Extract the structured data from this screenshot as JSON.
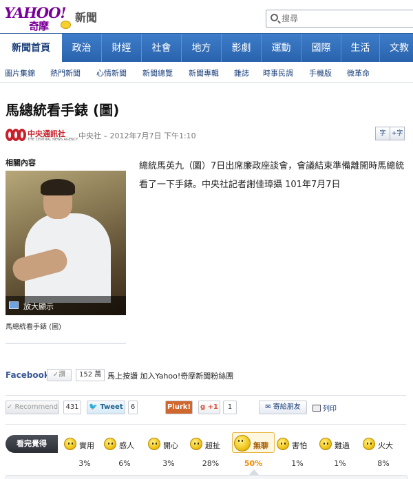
{
  "header": {
    "logo_text": "YAHOO!",
    "logo_sub": "奇摩",
    "section_name": "新聞",
    "search_placeholder": "搜尋"
  },
  "mainnav": {
    "tabs": [
      {
        "label": "新聞首頁",
        "active": true
      },
      {
        "label": "政治"
      },
      {
        "label": "財經"
      },
      {
        "label": "社會"
      },
      {
        "label": "地方"
      },
      {
        "label": "影劇"
      },
      {
        "label": "運動"
      },
      {
        "label": "國際"
      },
      {
        "label": "生活"
      },
      {
        "label": "文教"
      }
    ]
  },
  "subnav": {
    "items": [
      "圖片集錦",
      "熱門新聞",
      "心情新聞",
      "新聞總覽",
      "新聞專輯",
      "雜誌",
      "時事民調",
      "手機版",
      "微革命"
    ]
  },
  "article": {
    "title": "馬總統看手錶 (圖)",
    "source_logo_name": "中央通訊社",
    "source_logo_en": "THE CENTRAL NEWS AGENCY",
    "byline": "中央社 – 2012年7月7日 下午1:10",
    "font_small": "字",
    "font_large": "+字",
    "related_heading": "相關內容",
    "zoom_label": "放大顯示",
    "caption": "馬總統看手錶 (圖)",
    "body": "總統馬英九（圖）7日出席廉政座談會，會議結束準備離開時馬總統看了一下手錶。中央社記者謝佳璋攝 101年7月7日"
  },
  "facebook": {
    "title": "Facebook",
    "like_label": "讚",
    "count": "152 萬",
    "cta": "馬上按讚 加入Yahoo!奇摩新聞粉絲團"
  },
  "share": {
    "recommend_label": "Recommend",
    "recommend_count": "431",
    "tweet_label": "Tweet",
    "tweet_count": "6",
    "plurk_label": "Plurk!",
    "gplus_label": "+1",
    "gplus_count": "1",
    "mail_label": "寄給朋友",
    "print_label": "列印"
  },
  "mood": {
    "label": "看完覺得",
    "options": [
      {
        "name": "實用",
        "pct": "3%"
      },
      {
        "name": "感人",
        "pct": "6%"
      },
      {
        "name": "開心",
        "pct": "3%"
      },
      {
        "name": "超扯",
        "pct": "28%"
      },
      {
        "name": "無聊",
        "pct": "50%",
        "selected": true
      },
      {
        "name": "害怕",
        "pct": "1%"
      },
      {
        "name": "難過",
        "pct": "1%"
      },
      {
        "name": "火大",
        "pct": "8%"
      }
    ]
  },
  "colors": {
    "nav_blue": "#2962ad",
    "link_blue": "#1a3f7a",
    "brand_purple": "#7b0099",
    "cna_red": "#c8202a",
    "selected_orange": "#f08a00"
  }
}
